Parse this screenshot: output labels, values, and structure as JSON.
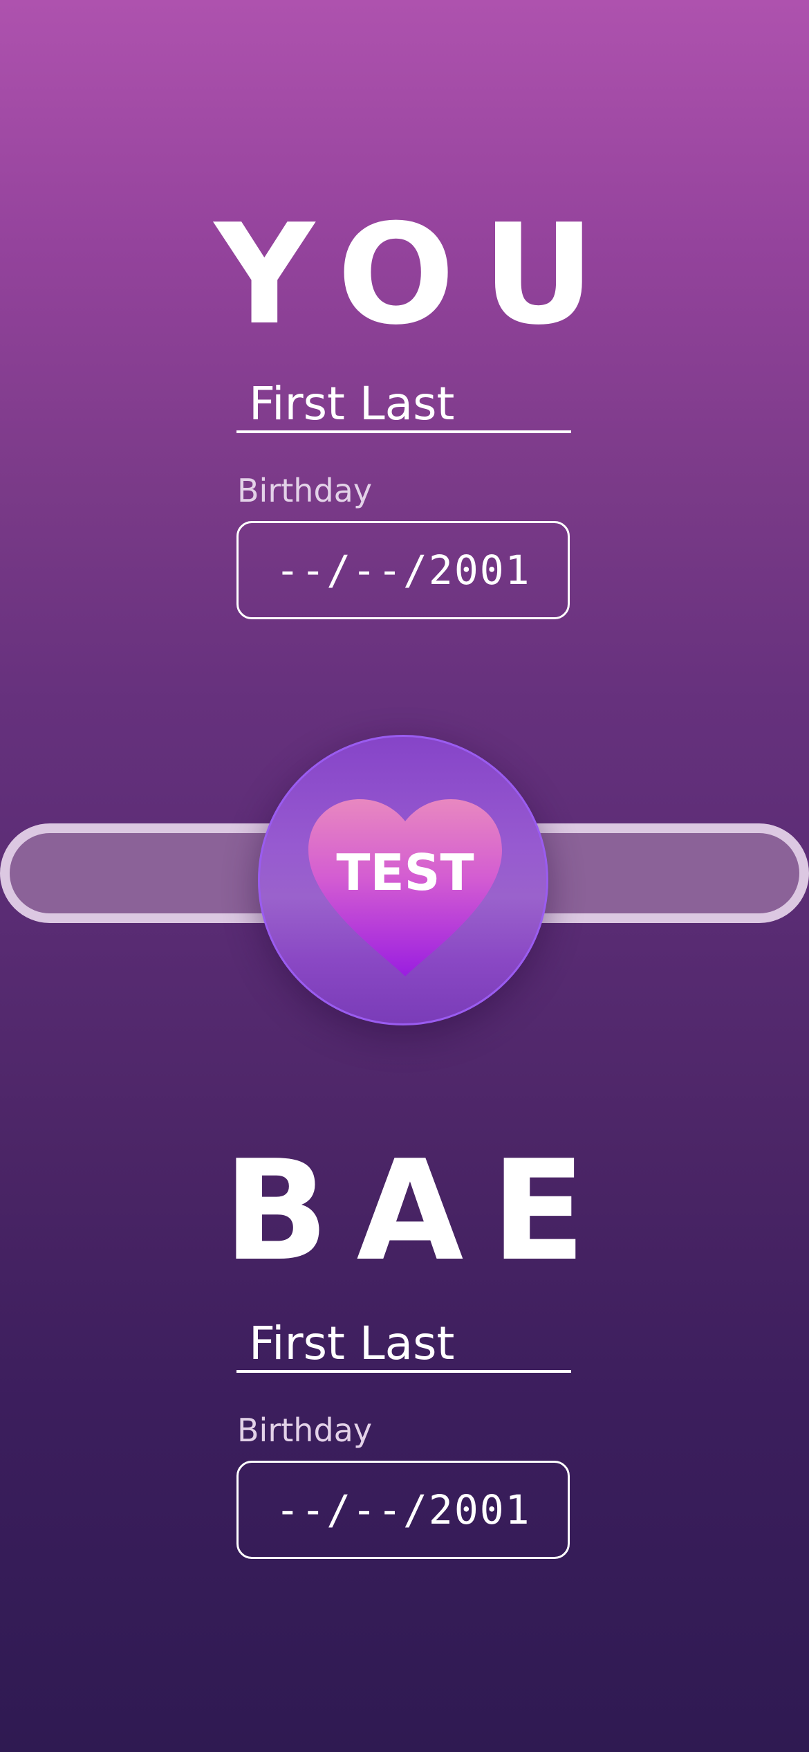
{
  "you_section": {
    "title": "YOU",
    "name_value": "First Last",
    "birthday_label": "Birthday",
    "birthday_value": "--/--/2001"
  },
  "test_button": {
    "label": "TEST",
    "icon": "heart-icon"
  },
  "bae_section": {
    "title": "BAE",
    "name_value": "First Last",
    "birthday_label": "Birthday",
    "birthday_value": "--/--/2001"
  },
  "colors": {
    "background_top": "#ae52ae",
    "background_bottom": "#2f1a52",
    "heart_top": "#e888c0",
    "heart_bottom": "#9a1ee0",
    "button_ring": "#9a5cf0",
    "track_border": "#dcc8e2",
    "track_fill": "#8b6298"
  }
}
